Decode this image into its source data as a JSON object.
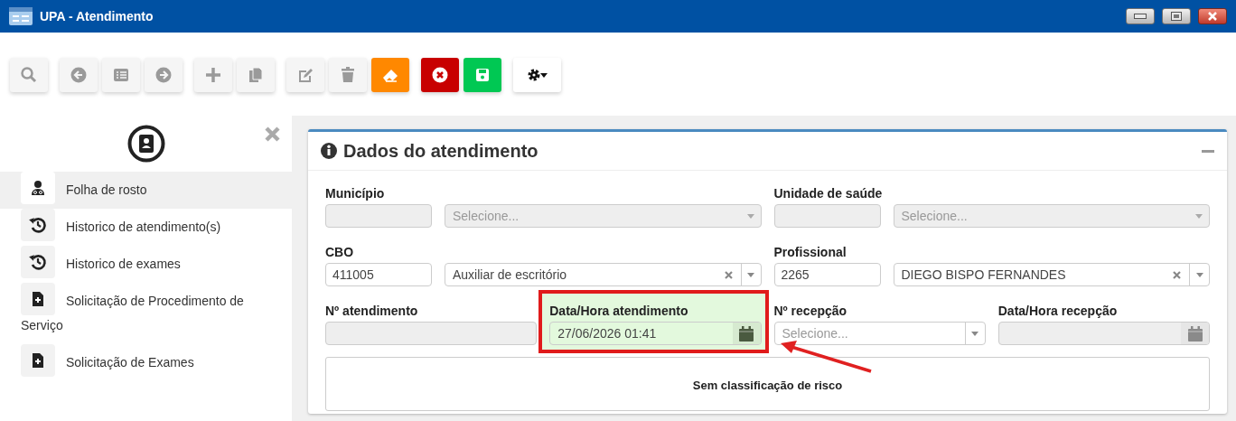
{
  "window": {
    "title": "UPA - Atendimento"
  },
  "sidebar": {
    "items": [
      {
        "label": "Folha de rosto",
        "selected": true
      },
      {
        "label": "Historico de atendimento(s)",
        "selected": false
      },
      {
        "label": "Historico de exames",
        "selected": false
      },
      {
        "label": "Solicitação de Procedimento de Serviço",
        "selected": false
      },
      {
        "label": "Solicitação de Exames",
        "selected": false
      }
    ]
  },
  "panel": {
    "title": "Dados do atendimento",
    "rows": [
      [
        {
          "label": "Município",
          "highlighted": false,
          "controls": [
            {
              "kind": "input",
              "disabled": true
            },
            {
              "kind": "select",
              "placeholder": "Selecione...",
              "disabled": true,
              "clearable": false
            }
          ]
        },
        {
          "label": "Unidade de saúde",
          "highlighted": false,
          "controls": [
            {
              "kind": "input",
              "disabled": true
            },
            {
              "kind": "select",
              "placeholder": "Selecione...",
              "disabled": true,
              "clearable": false
            }
          ]
        }
      ],
      [
        {
          "label": "CBO",
          "highlighted": false,
          "controls": [
            {
              "kind": "input",
              "value": "411005",
              "disabled": false
            },
            {
              "kind": "select",
              "value": "Auxiliar de escritório",
              "disabled": false,
              "clearable": true
            }
          ]
        },
        {
          "label": "Profissional",
          "highlighted": false,
          "controls": [
            {
              "kind": "input",
              "value": "2265",
              "disabled": false
            },
            {
              "kind": "select",
              "value": "DIEGO BISPO FERNANDES",
              "disabled": false,
              "clearable": true
            }
          ]
        }
      ],
      [
        {
          "label": "Nº atendimento",
          "highlighted": false,
          "controls": [
            {
              "kind": "input",
              "disabled": true
            }
          ]
        },
        {
          "label": "Data/Hora atendimento",
          "highlighted": true,
          "controls": [
            {
              "kind": "date",
              "value": "27/06/2026 01:41",
              "disabled": false
            }
          ]
        },
        {
          "label": "Nº recepção",
          "highlighted": false,
          "controls": [
            {
              "kind": "select",
              "placeholder": "Selecione...",
              "disabled": false,
              "clearable": false
            }
          ]
        },
        {
          "label": "Data/Hora recepção",
          "highlighted": false,
          "controls": [
            {
              "kind": "date",
              "disabled": true
            }
          ]
        }
      ]
    ],
    "risk": "Sem classificação de risco"
  }
}
